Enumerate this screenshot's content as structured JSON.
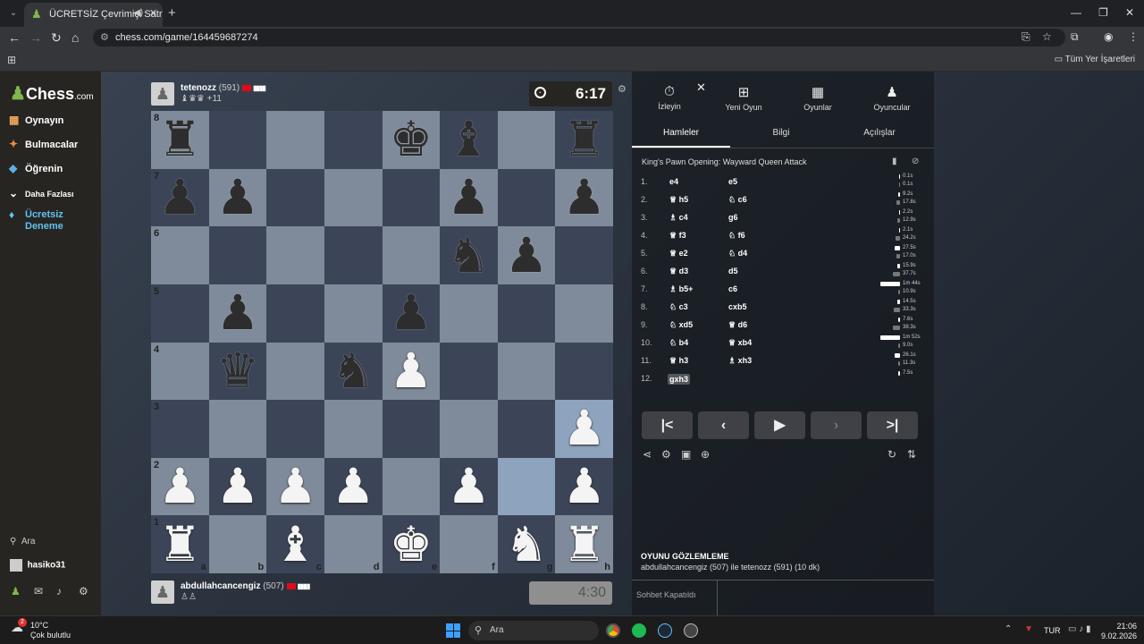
{
  "browser": {
    "tab_title": "ÜCRETSİZ Çevrimiçi Satranç",
    "url": "chess.com/game/164459687274",
    "bookmarks_label": "Tüm Yer İşaretleri"
  },
  "sidebar": {
    "logo": "Chess",
    "logo_suffix": ".com",
    "items": [
      {
        "label": "Oynayın"
      },
      {
        "label": "Bulmacalar"
      },
      {
        "label": "Öğrenin"
      },
      {
        "label": "Daha Fazlası"
      },
      {
        "label": "Ücretsiz Deneme"
      }
    ],
    "search_label": "Ara",
    "username": "hasiko31"
  },
  "top_player": {
    "name": "tetenozz",
    "rating": "(591)",
    "captured": "♝♛♛ +11",
    "clock": "6:17"
  },
  "bottom_player": {
    "name": "abdullahcancengiz",
    "rating": "(507)",
    "captured": "♙♙",
    "clock": "4:30"
  },
  "board": {
    "ranks": [
      "8",
      "7",
      "6",
      "5",
      "4",
      "3",
      "2",
      "1"
    ],
    "files": [
      "a",
      "b",
      "c",
      "d",
      "e",
      "f",
      "g",
      "h"
    ],
    "position": [
      [
        "bR",
        "",
        "",
        "",
        "bK",
        "bB",
        "",
        "bR"
      ],
      [
        "bP",
        "bP",
        "",
        "",
        "",
        "bP",
        "",
        "bP"
      ],
      [
        "",
        "",
        "",
        "",
        "",
        "bN",
        "bP",
        ""
      ],
      [
        "",
        "bP",
        "",
        "",
        "bP",
        "",
        "",
        ""
      ],
      [
        "",
        "bQ",
        "",
        "bN",
        "wP",
        "",
        "",
        ""
      ],
      [
        "",
        "",
        "",
        "",
        "",
        "",
        "",
        "wP"
      ],
      [
        "wP",
        "wP",
        "wP",
        "wP",
        "",
        "wP",
        "",
        "wP"
      ],
      [
        "wR",
        "",
        "wB",
        "",
        "wK",
        "",
        "wN",
        "wR"
      ]
    ],
    "highlight": [
      "h3",
      "g2"
    ]
  },
  "panel": {
    "tabs": [
      "İzleyin",
      "Yeni Oyun",
      "Oyunlar",
      "Oyuncular"
    ],
    "subtabs": [
      "Hamleler",
      "Bilgi",
      "Açılışlar"
    ],
    "opening": "King's Pawn Opening: Wayward Queen Attack",
    "moves": [
      {
        "no": "1.",
        "w": "e4",
        "b": "e5",
        "wt": "0.1s",
        "bt": "0.1s",
        "wf": 0.01,
        "bf": 0.01
      },
      {
        "no": "2.",
        "w": "♕ h5",
        "b": "♘ c6",
        "wt": "9.2s",
        "bt": "17.8s",
        "wf": 0.09,
        "bf": 0.17
      },
      {
        "no": "3.",
        "w": "♗ c4",
        "b": "g6",
        "wt": "2.2s",
        "bt": "12.9s",
        "wf": 0.02,
        "bf": 0.12
      },
      {
        "no": "4.",
        "w": "♕ f3",
        "b": "♘ f6",
        "wt": "2.1s",
        "bt": "24.2s",
        "wf": 0.02,
        "bf": 0.23
      },
      {
        "no": "5.",
        "w": "♕ e2",
        "b": "♘ d4",
        "wt": "27.5s",
        "bt": "17.0s",
        "wf": 0.26,
        "bf": 0.16
      },
      {
        "no": "6.",
        "w": "♕ d3",
        "b": "d5",
        "wt": "15.9s",
        "bt": "37.7s",
        "wf": 0.15,
        "bf": 0.36
      },
      {
        "no": "7.",
        "w": "♗ b5+",
        "b": "c6",
        "wt": "1m 44s",
        "bt": "10.9s",
        "wf": 0.99,
        "bf": 0.1
      },
      {
        "no": "8.",
        "w": "♘ c3",
        "b": "cxb5",
        "wt": "14.5s",
        "bt": "33.3s",
        "wf": 0.14,
        "bf": 0.32
      },
      {
        "no": "9.",
        "w": "♘ xd5",
        "b": "♕ d6",
        "wt": "7.6s",
        "bt": "38.3s",
        "wf": 0.07,
        "bf": 0.37
      },
      {
        "no": "10.",
        "w": "♘ b4",
        "b": "♕ xb4",
        "wt": "1m 52s",
        "bt": "9.0s",
        "wf": 1.0,
        "bf": 0.09
      },
      {
        "no": "11.",
        "w": "♕ h3",
        "b": "♗ xh3",
        "wt": "26.1s",
        "bt": "11.3s",
        "wf": 0.25,
        "bf": 0.11
      },
      {
        "no": "12.",
        "w": "gxh3",
        "b": "",
        "wt": "7.5s",
        "bt": "",
        "wf": 0.07,
        "bf": 0
      }
    ],
    "observe_title": "OYUNU GÖZLEMLEME",
    "observe_desc": "abdullahcancengiz (507) ile tetenozz (591) (10 dk)",
    "chat_status": "Sohbet Kapatıldı"
  },
  "taskbar": {
    "weather_temp": "10°C",
    "weather_desc": "Çok bulutlu",
    "weather_badge": "2",
    "search": "Ara",
    "lang": "TUR",
    "time": "21:06",
    "date": "9.02.2026"
  },
  "colors": {
    "accent": "#81b64c",
    "board_light": "#7f8b9b",
    "board_dark": "#3c4558",
    "highlight": "#8ea3bd"
  }
}
